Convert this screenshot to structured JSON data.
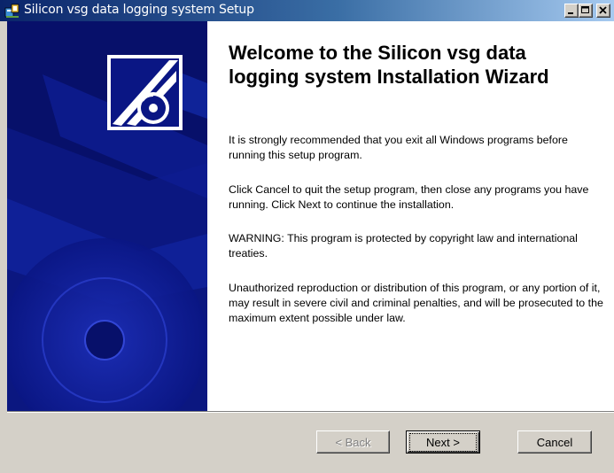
{
  "window": {
    "title": "Silicon vsg data logging system Setup",
    "icon": "setup-icon"
  },
  "content": {
    "heading": "Welcome to the Silicon vsg data logging system Installation Wizard",
    "paragraphs": [
      "It is strongly recommended that you exit all Windows programs before running this setup program.",
      "Click Cancel to quit the setup program, then close any programs you have running.  Click Next to continue the installation.",
      "WARNING: This program is protected by copyright law and international treaties.",
      "Unauthorized reproduction or distribution of this program, or any portion of it, may result in severe civil and criminal penalties, and will be prosecuted to the maximum extent possible under law."
    ]
  },
  "buttons": {
    "back": "< Back",
    "next": "Next >",
    "cancel": "Cancel"
  },
  "colors": {
    "titlebar_start": "#0a246a",
    "titlebar_end": "#a6caf0",
    "banner_bg": "#07106a",
    "dialog_bg": "#d4d0c8"
  }
}
